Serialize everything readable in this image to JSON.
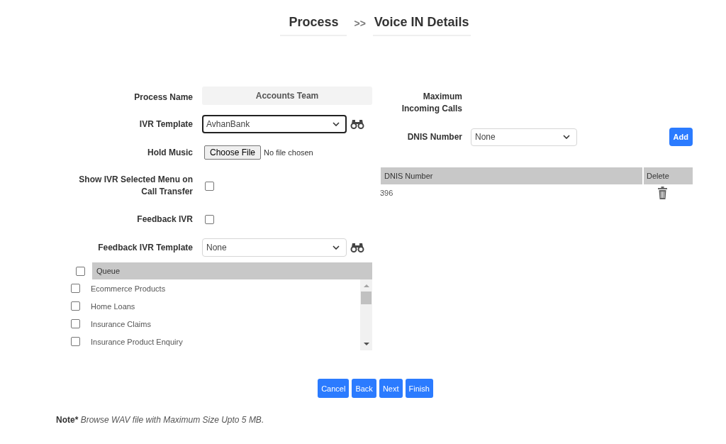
{
  "breadcrumb": {
    "items": [
      {
        "label": "Process"
      },
      {
        "label": "Voice IN Details"
      }
    ],
    "separator": ">>"
  },
  "form_left": {
    "fields": [
      {
        "kind": "readonly",
        "label": "Process Name",
        "value": "Accounts Team"
      },
      {
        "kind": "select",
        "label": "IVR Template",
        "value": "AvhanBank",
        "focused": true,
        "lookup": true
      },
      {
        "kind": "file",
        "label": "Hold Music",
        "button": "Choose File",
        "status": "No file chosen"
      },
      {
        "kind": "checkbox",
        "label": "Show IVR Selected Menu on Call Transfer",
        "checked": false
      },
      {
        "kind": "checkbox",
        "label": "Feedback IVR",
        "checked": false
      },
      {
        "kind": "select",
        "label": "Feedback IVR Template",
        "value": "None",
        "focused": false,
        "lookup": true
      }
    ]
  },
  "queue_table": {
    "header_checked": false,
    "column": "Queue",
    "rows": [
      {
        "name": "Ecommerce Products",
        "checked": false
      },
      {
        "name": "Home Loans",
        "checked": false
      },
      {
        "name": "Insurance Claims",
        "checked": false
      },
      {
        "name": "Insurance Product Enquiry",
        "checked": false
      }
    ]
  },
  "form_right": {
    "fields": [
      {
        "kind": "label",
        "label": "Maximum Incoming Calls"
      },
      {
        "kind": "select",
        "label": "DNIS Number",
        "value": "None",
        "focused": false,
        "action": "Add"
      }
    ]
  },
  "dnis_table": {
    "columns": [
      "DNIS Number",
      "Delete"
    ],
    "rows": [
      {
        "number": "396"
      }
    ]
  },
  "buttons": [
    "Cancel",
    "Back",
    "Next",
    "Finish"
  ],
  "note": {
    "label": "Note*",
    "text": "Browse WAV file with Maximum Size Upto 5 MB."
  }
}
